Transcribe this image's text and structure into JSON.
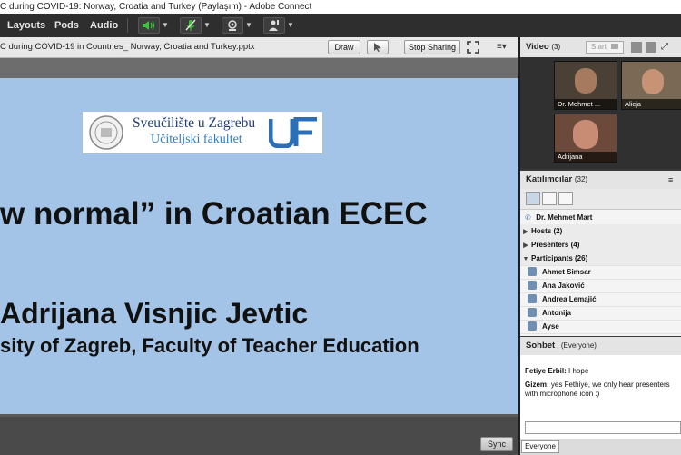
{
  "window": {
    "title": "C during COVID-19:  Norway, Croatia and Turkey (Paylaşım) - Adobe Connect"
  },
  "menubar": {
    "items": [
      "Layouts",
      "Pods",
      "Audio"
    ]
  },
  "share": {
    "title": "C during COVID-19 in Countries_ Norway, Croatia and Turkey.pptx",
    "draw_label": "Draw",
    "stop_label": "Stop Sharing",
    "sync_label": "Sync"
  },
  "slide": {
    "logo_line1": "Sveučilište u Zagrebu",
    "logo_line2": "Učiteljski fakultet",
    "heading": "w normal” in Croatian ECEC",
    "author": "Adrijana Visnjic Jevtic",
    "affiliation": "sity of Zagreb, Faculty of Teacher Education"
  },
  "video": {
    "title": "Video",
    "count": "(3)",
    "start_label": "Start",
    "tiles": [
      "Dr. Mehmet ...",
      "Alicja",
      "Adrijana"
    ]
  },
  "attendees": {
    "title": "Katılımcılar",
    "count": "(32)",
    "presenter_top": "Dr. Mehmet Mart",
    "groups": [
      "Hosts (2)",
      "Presenters (4)",
      "Participants (26)"
    ],
    "participants": [
      "Ahmet Simsar",
      "Ana Jaković",
      "Andrea Lemajić",
      "Antonija",
      "Ayse"
    ]
  },
  "chat": {
    "title": "Sohbet",
    "scope": "(Everyone)",
    "messages": [
      {
        "author": "Fetiye Erbil:",
        "text": " I hope"
      },
      {
        "author": "Gizem:",
        "text": " yes Fethiye, we only hear presenters with microphone icon :)"
      }
    ],
    "tab_label": "Everyone"
  },
  "colors": {
    "slide_bg": "#a3c4e6",
    "toolbar_bg": "#2e2e2e",
    "mic_on": "#3cc23c"
  }
}
